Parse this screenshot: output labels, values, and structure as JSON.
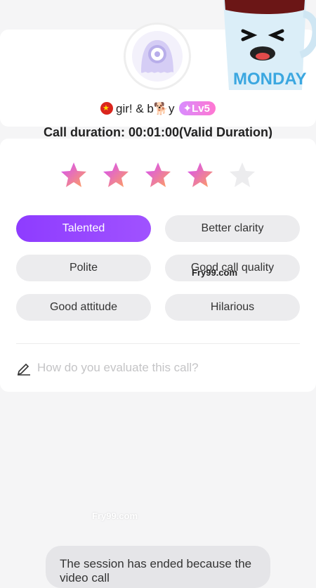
{
  "user": {
    "name": "gir! & b🐕y",
    "level": "Lv5",
    "flag_icon": "vietnam-flag-icon",
    "avatar_icon": "default-avatar-icon"
  },
  "call": {
    "duration_text": "Call duration: 00:01:00(Valid Duration)"
  },
  "sticker": {
    "text": "MONDAY"
  },
  "rating": {
    "value": 4,
    "max": 5,
    "filled_color": "#ff7aa0",
    "empty_color": "#ececee"
  },
  "tags": [
    {
      "label": "Talented",
      "selected": true
    },
    {
      "label": "Better clarity",
      "selected": false
    },
    {
      "label": "Polite",
      "selected": false
    },
    {
      "label": "Good call quality",
      "selected": false
    },
    {
      "label": "Good attitude",
      "selected": false
    },
    {
      "label": "Hilarious",
      "selected": false
    }
  ],
  "evaluation": {
    "placeholder": "How do you evaluate this call?",
    "icon": "pencil-icon"
  },
  "watermarks": [
    "Fry99.com",
    "Fry99.com"
  ],
  "bottom_message": "The session has ended because the video call"
}
